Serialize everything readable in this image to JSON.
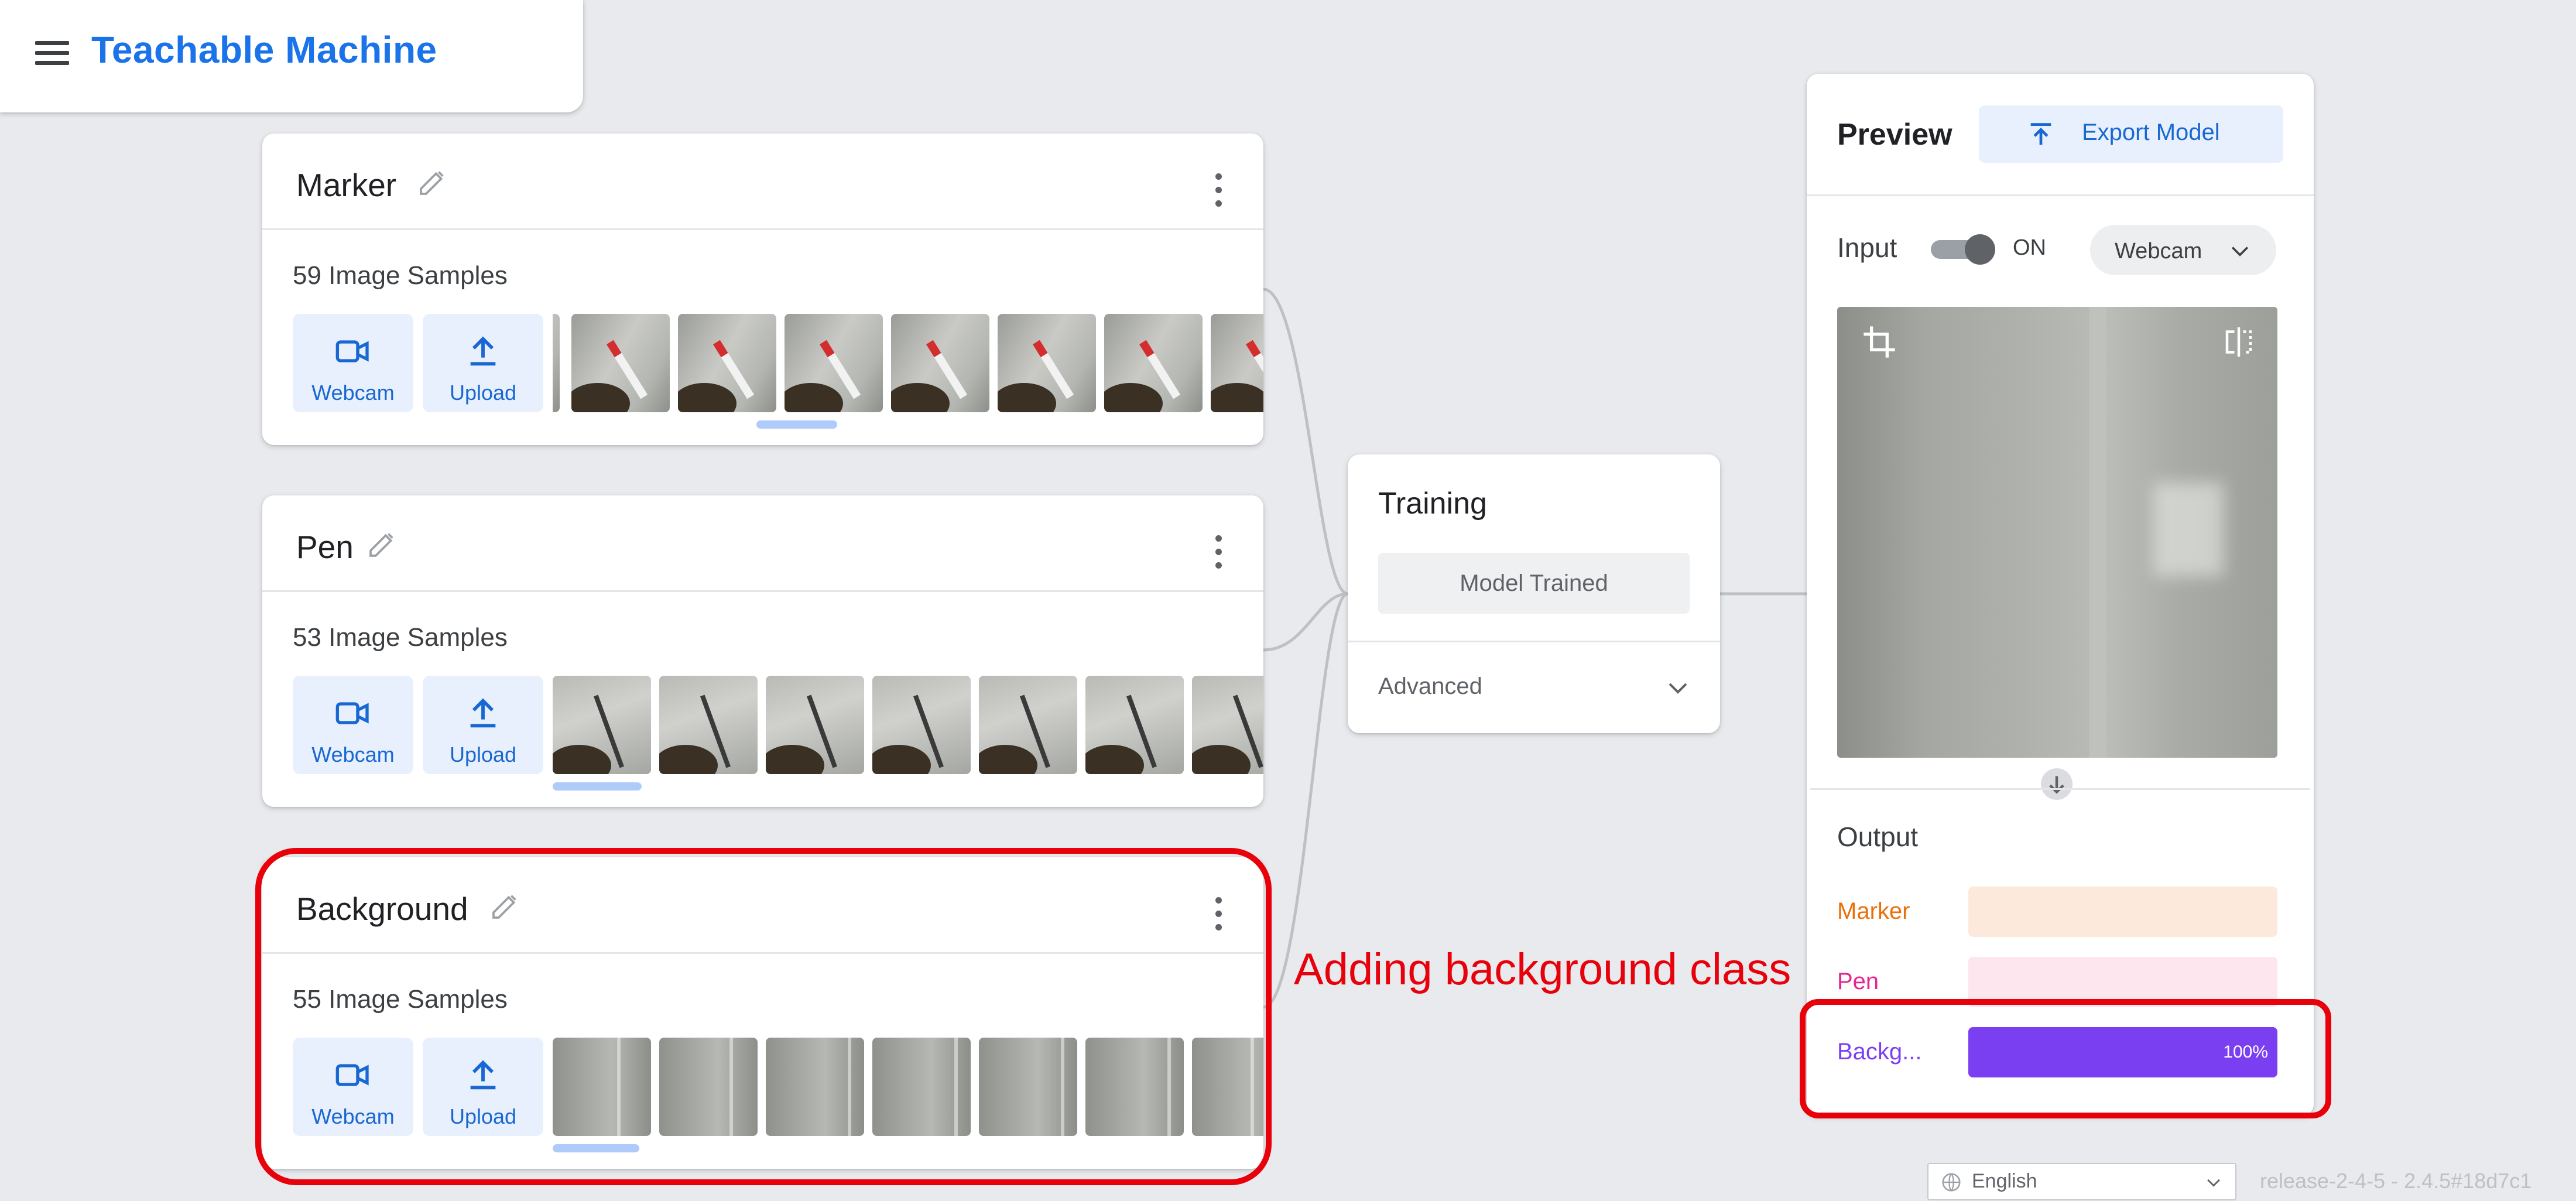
{
  "app": {
    "title": "Teachable Machine"
  },
  "classes": [
    {
      "name": "Marker",
      "samples": "59 Image Samples",
      "webcam_label": "Webcam",
      "upload_label": "Upload"
    },
    {
      "name": "Pen",
      "samples": "53 Image Samples",
      "webcam_label": "Webcam",
      "upload_label": "Upload"
    },
    {
      "name": "Background",
      "samples": "55 Image Samples",
      "webcam_label": "Webcam",
      "upload_label": "Upload"
    }
  ],
  "training": {
    "title": "Training",
    "button_label": "Model Trained",
    "advanced_label": "Advanced"
  },
  "preview": {
    "title": "Preview",
    "export_label": "Export Model",
    "input_label": "Input",
    "toggle_state": "ON",
    "source_select": "Webcam",
    "output_label": "Output",
    "outputs": [
      {
        "name": "Marker",
        "value": 0,
        "label": "",
        "color": "#e8710a",
        "track": "#fde9dc"
      },
      {
        "name": "Pen",
        "value": 0,
        "label": "",
        "color": "#e52592",
        "track": "#fde6ee"
      },
      {
        "name": "Backg...",
        "value": 1.0,
        "label": "100%",
        "color": "#7b3ff2",
        "track": "#ece4fd"
      }
    ]
  },
  "annotation": {
    "text": "Adding background class",
    "color": "#e8000b"
  },
  "footer": {
    "language": "English",
    "version": "release-2-4-5 - 2.4.5#18d7c1"
  },
  "icons": [
    "menu-icon",
    "edit-icon",
    "more-vert-icon",
    "videocam-icon",
    "upload-icon",
    "chevron-down-icon",
    "export-icon",
    "crop-icon",
    "flip-icon",
    "arrow-down-icon",
    "globe-icon"
  ]
}
